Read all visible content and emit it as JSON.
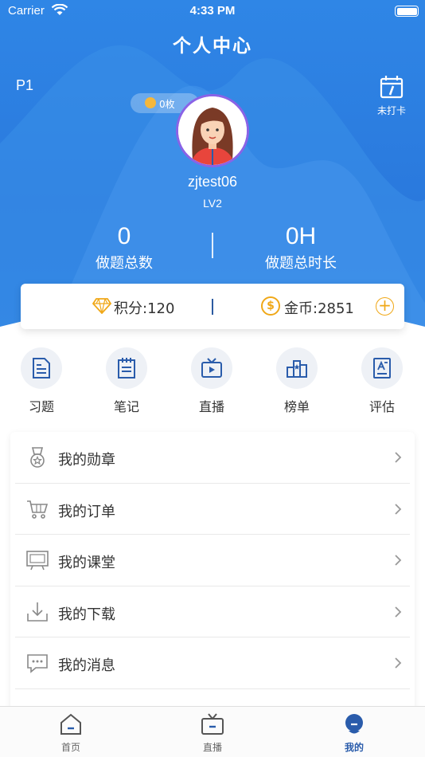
{
  "status_bar": {
    "carrier": "Carrier",
    "time": "4:33 PM"
  },
  "header": {
    "title": "个人中心",
    "left_label": "P1",
    "checkin_label": "未打卡",
    "badge_count": "0枚",
    "username": "zjtest06",
    "level": "LV2",
    "stats": [
      {
        "value": "0",
        "label": "做题总数"
      },
      {
        "value": "0H",
        "label": "做题总时长"
      }
    ]
  },
  "wallet": {
    "points_label": "积分:120",
    "coins_label": "金币:2851",
    "coin_symbol": "$",
    "plus_symbol": "+"
  },
  "quick_actions": [
    {
      "label": "习题",
      "icon": "exercise-icon"
    },
    {
      "label": "笔记",
      "icon": "notes-icon"
    },
    {
      "label": "直播",
      "icon": "live-tv-icon"
    },
    {
      "label": "榜单",
      "icon": "ranking-icon"
    },
    {
      "label": "评估",
      "icon": "assessment-icon"
    }
  ],
  "menu": [
    {
      "label": "我的勋章",
      "icon": "medal-icon"
    },
    {
      "label": "我的订单",
      "icon": "cart-icon"
    },
    {
      "label": "我的课堂",
      "icon": "classroom-icon"
    },
    {
      "label": "我的下载",
      "icon": "download-icon"
    },
    {
      "label": "我的消息",
      "icon": "message-icon"
    }
  ],
  "tabbar": [
    {
      "label": "首页",
      "icon": "home-icon",
      "active": false
    },
    {
      "label": "直播",
      "icon": "tv-icon",
      "active": false
    },
    {
      "label": "我的",
      "icon": "profile-icon",
      "active": true
    }
  ],
  "colors": {
    "header_blue": "#2a7ddf",
    "accent_gold": "#f0a818",
    "active_tab": "#2a5cab",
    "icon_blue": "#2a5cab"
  }
}
